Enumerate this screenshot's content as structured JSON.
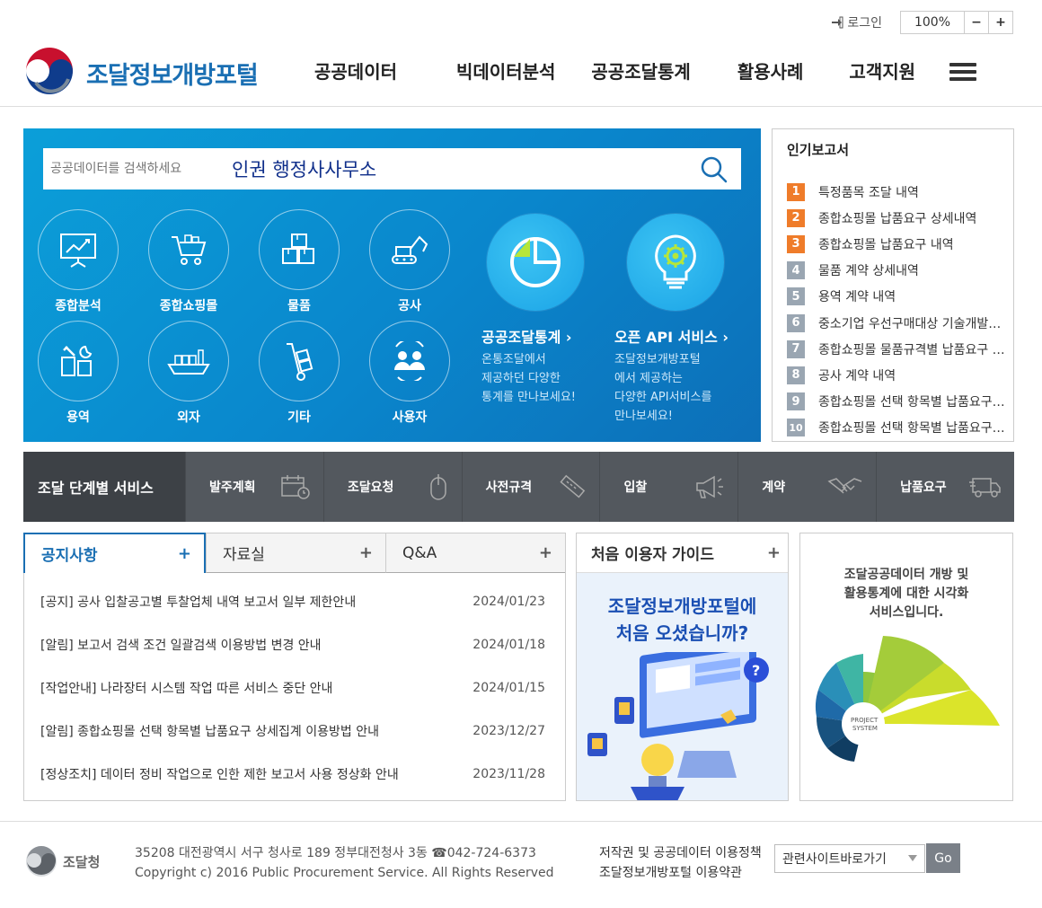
{
  "util": {
    "login_label": "로그인",
    "zoom": "100%",
    "zoom_minus": "−",
    "zoom_plus": "+"
  },
  "header": {
    "site_title": "조달정보개방포털",
    "nav": [
      "공공데이터",
      "빅데이터분석",
      "공공조달통계",
      "활용사례",
      "고객지원"
    ]
  },
  "search": {
    "placeholder": "공공데이터를 검색하세요",
    "typed_text": "인권 행정사사무소"
  },
  "categories": [
    "종합분석",
    "종합쇼핑몰",
    "물품",
    "공사",
    "용역",
    "외자",
    "기타",
    "사용자"
  ],
  "services": [
    {
      "title": "공공조달통계 ›",
      "desc": [
        "온통조달에서",
        "제공하던 다양한",
        "통계를 만나보세요!"
      ]
    },
    {
      "title": "오픈 API 서비스 ›",
      "desc": [
        "조달정보개방포털",
        "에서 제공하는",
        "다양한 API서비스를",
        "만나보세요!"
      ]
    }
  ],
  "popular": {
    "title": "인기보고서",
    "items": [
      {
        "rank": "1",
        "text": "특정품목 조달 내역",
        "color": "#ef7c2a"
      },
      {
        "rank": "2",
        "text": "종합쇼핑몰 납품요구 상세내역",
        "color": "#ef7c2a"
      },
      {
        "rank": "3",
        "text": "종합쇼핑몰 납품요구 내역",
        "color": "#ef7c2a"
      },
      {
        "rank": "4",
        "text": "물품 계약 상세내역",
        "color": "#9aa6b2"
      },
      {
        "rank": "5",
        "text": "용역 계약 내역",
        "color": "#9aa6b2"
      },
      {
        "rank": "6",
        "text": "중소기업 우선구매대상 기술개발제품",
        "color": "#9aa6b2"
      },
      {
        "rank": "7",
        "text": "종합쇼핑몰 물품규격별 납품요구 내역",
        "color": "#9aa6b2"
      },
      {
        "rank": "8",
        "text": "공사 계약 내역",
        "color": "#9aa6b2"
      },
      {
        "rank": "9",
        "text": "종합쇼핑몰 선택 항목별 납품요구 내역",
        "color": "#9aa6b2"
      },
      {
        "rank": "10",
        "text": "종합쇼핑몰 선택 항목별 납품요구 상세",
        "color": "#9aa6b2"
      }
    ]
  },
  "steps": {
    "title": "조달 단계별 서비스",
    "items": [
      "발주계획",
      "조달요청",
      "사전규격",
      "입찰",
      "계약",
      "납품요구"
    ]
  },
  "notice": {
    "tabs": [
      "공지사항",
      "자료실",
      "Q&A"
    ],
    "plus": "+",
    "rows": [
      {
        "text": "[공지] 공사 입찰공고별 투찰업체 내역 보고서 일부 제한안내",
        "date": "2024/01/23"
      },
      {
        "text": "[알림] 보고서 검색 조건 일괄검색 이용방법 변경 안내",
        "date": "2024/01/18"
      },
      {
        "text": "[작업안내] 나라장터 시스템 작업 따른 서비스 중단 안내",
        "date": "2024/01/15"
      },
      {
        "text": "[알림] 종합쇼핑몰 선택 항목별 납품요구 상세집계 이용방법 안내",
        "date": "2023/12/27"
      },
      {
        "text": "[정상조치] 데이터 정비 작업으로 인한 제한 보고서 사용 정상화 안내",
        "date": "2023/11/28"
      }
    ]
  },
  "guide": {
    "title": "처음 이용자 가이드",
    "plus": "+",
    "line1": "조달정보개방포털에",
    "line2": "처음 오셨습니까?"
  },
  "viz": {
    "text": "조달공공데이터 개방 및\n활용통계에 대한 시각화\n서비스입니다."
  },
  "footer": {
    "org": "조달청",
    "address": "35208 대전광역시 서구 청사로 189 정부대전청사 3동 ☎042-724-6373",
    "copyright": "Copyright c) 2016 Public Procurement Service. All Rights Reserved",
    "policy1": "저작권 및 공공데이터 이용정책",
    "policy2": "조달정보개방포털 이용약관",
    "select": "관련사이트바로가기",
    "go": "Go"
  },
  "colors": {
    "brand": "#1a6fb3",
    "hero": "#0b9fd9",
    "rank_top": "#ef7c2a",
    "rank_other": "#9aa6b2"
  }
}
